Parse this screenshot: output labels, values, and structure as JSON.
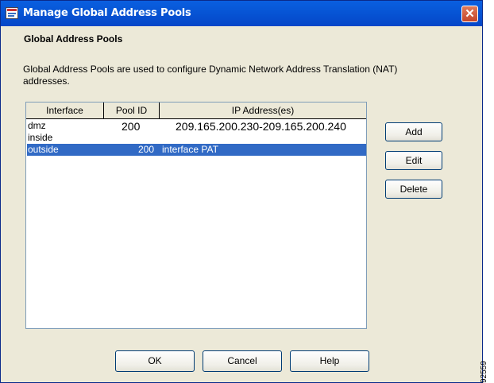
{
  "window": {
    "title": "Manage Global Address Pools",
    "close_label": "✕"
  },
  "section": {
    "title": "Global Address Pools",
    "description": "Global Address Pools are used to configure Dynamic Network Address Translation (NAT) addresses."
  },
  "table": {
    "columns": [
      "Interface",
      "Pool ID",
      "IP Address(es)"
    ],
    "rows": [
      {
        "interface": "dmz",
        "pool_id": "200",
        "ip": "209.165.200.230-209.165.200.240",
        "selected": false
      },
      {
        "interface": "inside",
        "pool_id": "",
        "ip": "",
        "selected": false
      },
      {
        "interface": "outside",
        "pool_id": "200",
        "ip": "interface PAT",
        "selected": true
      }
    ]
  },
  "side_buttons": {
    "add": "Add",
    "edit": "Edit",
    "delete": "Delete"
  },
  "bottom_buttons": {
    "ok": "OK",
    "cancel": "Cancel",
    "help": "Help"
  },
  "figure_id": "92559",
  "colors": {
    "selection": "#316ac5",
    "title_bar": "#0756d6",
    "dialog_bg": "#ece9d8"
  }
}
